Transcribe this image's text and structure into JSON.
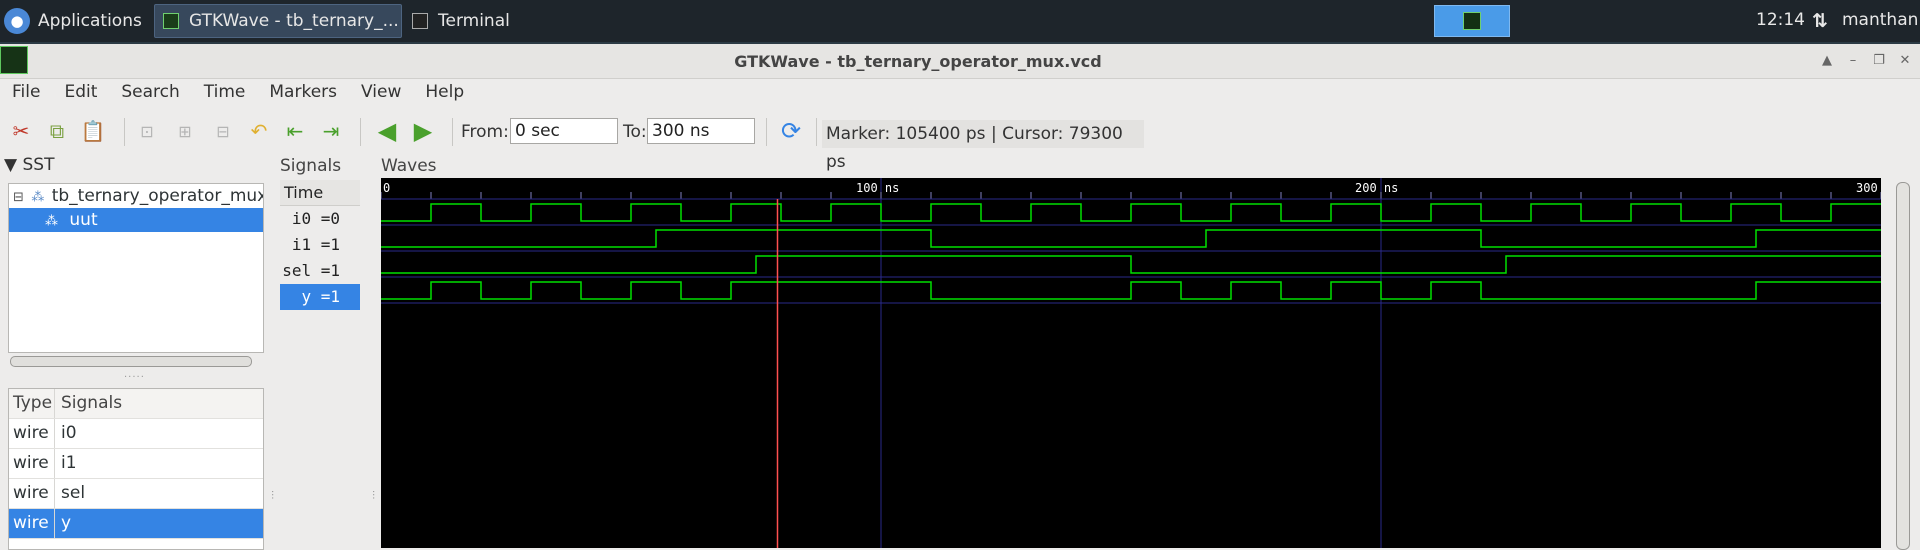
{
  "taskbar": {
    "applications_label": "Applications",
    "tasks": [
      {
        "label": "GTKWave - tb_ternary_...",
        "active": true
      },
      {
        "label": "Terminal",
        "active": false
      }
    ],
    "clock": "12:14",
    "user": "manthan"
  },
  "window": {
    "title": "GTKWave - tb_ternary_operator_mux.vcd"
  },
  "menu": [
    "File",
    "Edit",
    "Search",
    "Time",
    "Markers",
    "View",
    "Help"
  ],
  "toolbar": {
    "from_label": "From:",
    "from_value": "0 sec",
    "to_label": "To:",
    "to_value": "300 ns",
    "marker_cursor": "Marker: 105400 ps  |  Cursor: 79300 ps"
  },
  "sst": {
    "title": "SST",
    "tree": [
      {
        "label": "tb_ternary_operator_mux",
        "selected": false
      },
      {
        "label": "uut",
        "selected": true
      }
    ],
    "table": {
      "headers": [
        "Type",
        "Signals"
      ],
      "rows": [
        {
          "type": "wire",
          "name": "i0",
          "selected": false
        },
        {
          "type": "wire",
          "name": "i1",
          "selected": false
        },
        {
          "type": "wire",
          "name": "sel",
          "selected": false
        },
        {
          "type": "wire",
          "name": "y",
          "selected": true
        }
      ]
    }
  },
  "signals": {
    "title": "Signals",
    "time_header": "Time",
    "rows": [
      {
        "label": "i0 =0",
        "selected": false
      },
      {
        "label": "i1 =1",
        "selected": false
      },
      {
        "label": "sel =1",
        "selected": false
      },
      {
        "label": "y =1",
        "selected": true
      }
    ]
  },
  "waves": {
    "title": "Waves",
    "time_labels": [
      "0",
      "100 ns",
      "200 ns",
      "300"
    ],
    "time_range_ns": [
      0,
      300
    ],
    "marker_ns": 105.4,
    "cursor_ns": 79.3,
    "colors": {
      "wave": "#00e000",
      "marker": "#ff5050",
      "grid": "#2a2a8a",
      "bg": "#000000"
    }
  },
  "chart_data": {
    "type": "line",
    "title": "",
    "xlabel": "",
    "ylabel": "",
    "xlim": [
      0,
      300
    ],
    "x_unit": "ns",
    "series": [
      {
        "name": "i0",
        "transitions": [
          [
            0,
            0
          ],
          [
            10,
            1
          ],
          [
            20,
            0
          ],
          [
            30,
            1
          ],
          [
            40,
            0
          ],
          [
            50,
            1
          ],
          [
            60,
            0
          ],
          [
            70,
            1
          ],
          [
            80,
            0
          ],
          [
            90,
            1
          ],
          [
            100,
            0
          ],
          [
            110,
            1
          ],
          [
            120,
            0
          ],
          [
            130,
            1
          ],
          [
            140,
            0
          ],
          [
            150,
            1
          ],
          [
            160,
            0
          ],
          [
            170,
            1
          ],
          [
            180,
            0
          ],
          [
            190,
            1
          ],
          [
            200,
            0
          ],
          [
            210,
            1
          ],
          [
            220,
            0
          ],
          [
            230,
            1
          ],
          [
            240,
            0
          ],
          [
            250,
            1
          ],
          [
            260,
            0
          ],
          [
            270,
            1
          ],
          [
            280,
            0
          ],
          [
            290,
            1
          ]
        ]
      },
      {
        "name": "i1",
        "transitions": [
          [
            0,
            0
          ],
          [
            55,
            1
          ],
          [
            110,
            0
          ],
          [
            165,
            1
          ],
          [
            220,
            0
          ],
          [
            275,
            1
          ]
        ]
      },
      {
        "name": "sel",
        "transitions": [
          [
            0,
            0
          ],
          [
            75,
            1
          ],
          [
            150,
            0
          ],
          [
            225,
            1
          ]
        ]
      },
      {
        "name": "y",
        "transitions": [
          [
            0,
            0
          ],
          [
            10,
            1
          ],
          [
            20,
            0
          ],
          [
            30,
            1
          ],
          [
            40,
            0
          ],
          [
            50,
            1
          ],
          [
            60,
            0
          ],
          [
            70,
            1
          ],
          [
            110,
            0
          ],
          [
            150,
            1
          ],
          [
            160,
            0
          ],
          [
            170,
            1
          ],
          [
            180,
            0
          ],
          [
            190,
            1
          ],
          [
            200,
            0
          ],
          [
            210,
            1
          ],
          [
            220,
            0
          ],
          [
            275,
            1
          ]
        ]
      }
    ]
  }
}
